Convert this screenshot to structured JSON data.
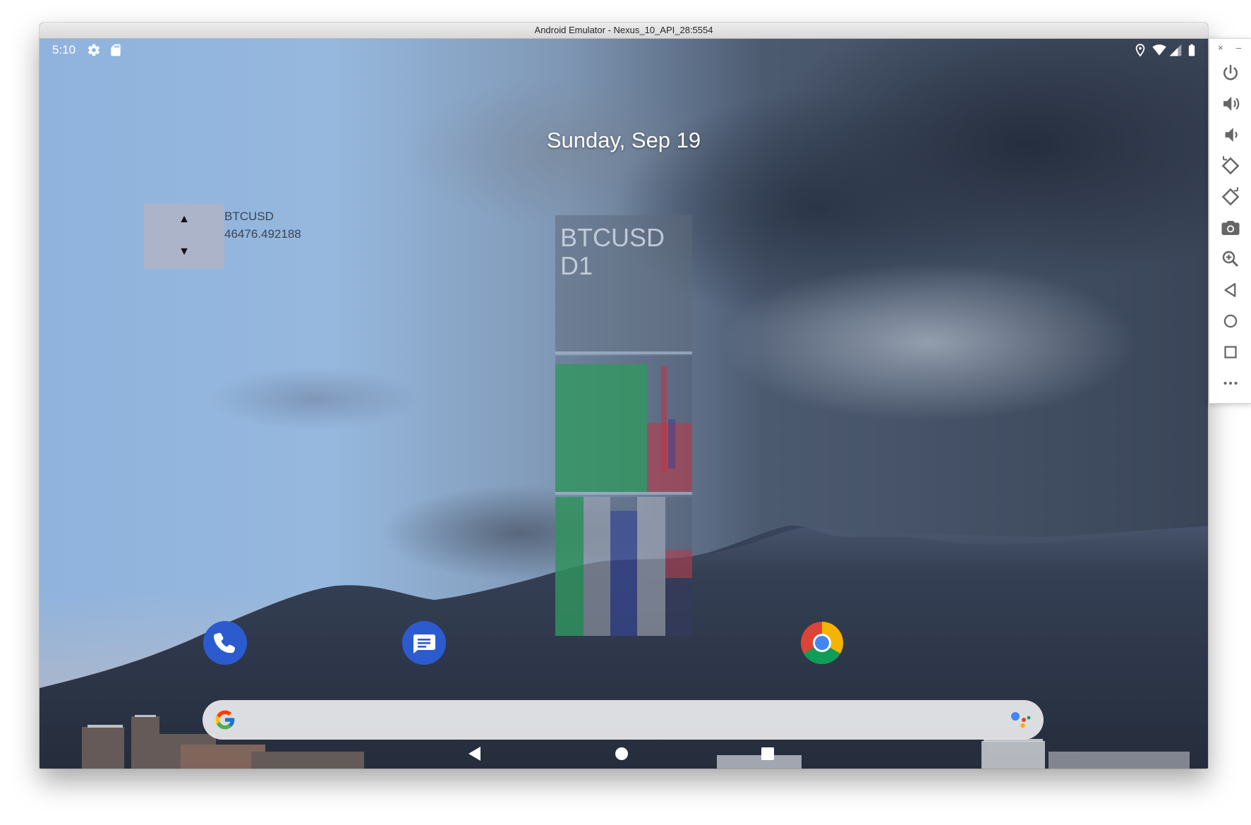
{
  "window": {
    "title": "Android Emulator - Nexus_10_API_28:5554"
  },
  "status_bar": {
    "time": "5:10",
    "left_icons": [
      "gear-icon",
      "sd-card-icon"
    ],
    "right_icons": [
      "location-icon",
      "wifi-icon",
      "cell-signal-icon",
      "battery-icon"
    ]
  },
  "home": {
    "date": "Sunday, Sep 19"
  },
  "ticker_widget": {
    "up_arrow": "▲",
    "down_arrow": "▼",
    "symbol": "BTCUSD",
    "price": "46476.492188"
  },
  "chart_widget": {
    "title_line1": "BTCUSD",
    "title_line2": "D1",
    "colors": {
      "bull": "#2e9a5c",
      "bear": "#c23444",
      "blue": "#2f3f9a"
    }
  },
  "dock": {
    "apps": [
      {
        "name": "Phone",
        "icon": "phone-icon",
        "color": "#2456c9"
      },
      {
        "name": "Messages",
        "icon": "messages-icon",
        "color": "#2456c9"
      },
      {
        "name": "Chrome",
        "icon": "chrome-icon",
        "color": "#4285f4"
      }
    ]
  },
  "search_bar": {
    "left_icon": "google-g-icon",
    "right_icon": "google-assistant-icon"
  },
  "nav_bar": {
    "buttons": [
      "back-icon",
      "home-icon",
      "recents-icon"
    ]
  },
  "side_toolbar": {
    "close_glyph": "×",
    "minimize_glyph": "–",
    "buttons": [
      "power-icon",
      "volume-up-icon",
      "volume-down-icon",
      "rotate-left-icon",
      "rotate-right-icon",
      "camera-icon",
      "zoom-icon",
      "back-icon",
      "home-icon",
      "overview-icon",
      "more-icon"
    ]
  }
}
